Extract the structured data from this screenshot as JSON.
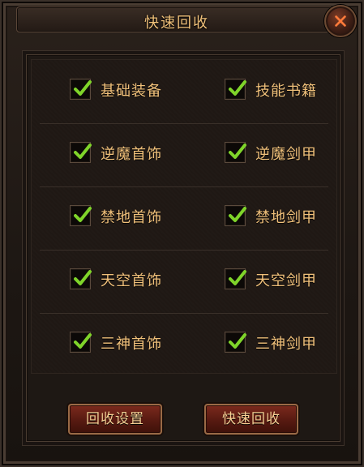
{
  "window": {
    "title": "快速回收",
    "close_icon": "close-icon"
  },
  "options": [
    {
      "left": {
        "label": "基础装备",
        "checked": true
      },
      "right": {
        "label": "技能书籍",
        "checked": true
      }
    },
    {
      "left": {
        "label": "逆魔首饰",
        "checked": true
      },
      "right": {
        "label": "逆魔剑甲",
        "checked": true
      }
    },
    {
      "left": {
        "label": "禁地首饰",
        "checked": true
      },
      "right": {
        "label": "禁地剑甲",
        "checked": true
      }
    },
    {
      "left": {
        "label": "天空首饰",
        "checked": true
      },
      "right": {
        "label": "天空剑甲",
        "checked": true
      }
    },
    {
      "left": {
        "label": "三神首饰",
        "checked": true
      },
      "right": {
        "label": "三神剑甲",
        "checked": true
      }
    }
  ],
  "buttons": {
    "recycle_settings": "回收设置",
    "quick_recycle": "快速回收"
  },
  "colors": {
    "accent_text": "#f0c07a",
    "check_green": "#7fd42a",
    "close_x": "#ff7a3a",
    "button_red": "#5a1b12"
  }
}
